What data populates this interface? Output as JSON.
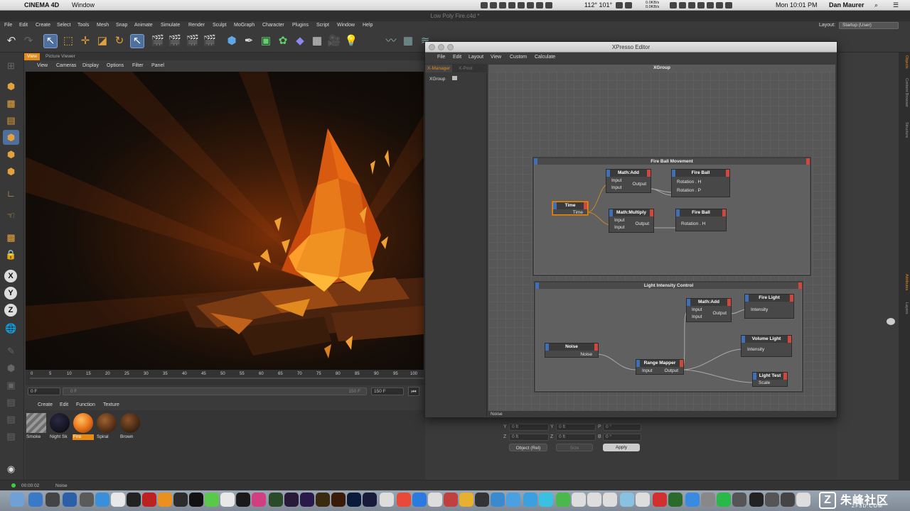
{
  "mac_menubar": {
    "app_name": "CINEMA 4D",
    "window_menu": "Window",
    "temps": "112° 101°",
    "net_up": "0.0KB/s",
    "net_down": "0.0KB/s",
    "clock": "Mon 10:01 PM",
    "user": "Dan Maurer"
  },
  "document_title": "Low Poly Fire.c4d *",
  "main_menu": [
    "File",
    "Edit",
    "Create",
    "Select",
    "Tools",
    "Mesh",
    "Snap",
    "Animate",
    "Simulate",
    "Render",
    "Sculpt",
    "MoGraph",
    "Character",
    "Plugins",
    "Script",
    "Window",
    "Help"
  ],
  "layout": {
    "label": "Layout:",
    "value": "Startup (User)"
  },
  "viewport": {
    "tabs": [
      "View",
      "Picture Viewer"
    ],
    "menu": [
      "View",
      "Cameras",
      "Display",
      "Options",
      "Filter",
      "Panel"
    ]
  },
  "timeline": {
    "ticks": [
      "0",
      "5",
      "10",
      "15",
      "20",
      "25",
      "30",
      "35",
      "40",
      "45",
      "50",
      "55",
      "60",
      "65",
      "70",
      "75",
      "80",
      "85",
      "90",
      "95",
      "100"
    ],
    "start_field": "0 F",
    "current_field": "0 F",
    "end_label": "150 F",
    "end_field": "150 F"
  },
  "materials": {
    "menu": [
      "Create",
      "Edit",
      "Function",
      "Texture"
    ],
    "items": [
      {
        "name": "Smoke",
        "color": "#8a8a8a"
      },
      {
        "name": "Night Sk",
        "color": "#1a1a2a"
      },
      {
        "name": "Fire",
        "color": "#e8741a"
      },
      {
        "name": "Spiral",
        "color": "#5a3518"
      },
      {
        "name": "Brown",
        "color": "#4a2d15"
      }
    ],
    "selected": "Fire"
  },
  "xpresso": {
    "title": "XPresso Editor",
    "menu": [
      "File",
      "Edit",
      "Layout",
      "View",
      "Custom",
      "Calculate"
    ],
    "tabs": [
      "X-Manager",
      "X-Pool"
    ],
    "tree_item": "XGroup",
    "canvas_title": "XGroup",
    "status": "Noise",
    "groups": [
      {
        "title": "Fire Ball Movement",
        "nodes": {
          "time": {
            "title": "Time",
            "ports": [
              "Time"
            ]
          },
          "math_add": {
            "title": "Math:Add",
            "inputs": [
              "Input",
              "Input"
            ],
            "output": "Output"
          },
          "math_mul": {
            "title": "Math:Multiply",
            "inputs": [
              "Input",
              "Input"
            ],
            "output": "Output"
          },
          "fireball1": {
            "title": "Fire Ball",
            "ports": [
              "Rotation . H",
              "Rotation . P"
            ]
          },
          "fireball2": {
            "title": "Fire Ball",
            "ports": [
              "Rotation . H"
            ]
          }
        }
      },
      {
        "title": "Light Intensity Control",
        "nodes": {
          "noise": {
            "title": "Noise",
            "ports": [
              "Noise"
            ]
          },
          "range_mapper": {
            "title": "Range Mapper",
            "input": "Input",
            "output": "Output"
          },
          "math_add": {
            "title": "Math:Add",
            "inputs": [
              "Input",
              "Input"
            ],
            "output": "Output"
          },
          "fire_light": {
            "title": "Fire Light",
            "ports": [
              "Intensity"
            ]
          },
          "volume_light": {
            "title": "Volume Light",
            "ports": [
              "Intensity"
            ]
          },
          "light_test": {
            "title": "Light Test",
            "ports": [
              "Scale"
            ]
          }
        }
      }
    ]
  },
  "coords": {
    "rows": [
      {
        "axis": "Y",
        "pos": "0 ft",
        "size": "0 ft",
        "rot_label": "P",
        "rot": "0 °"
      },
      {
        "axis": "Z",
        "pos": "0 ft",
        "size": "0 ft",
        "rot_label": "B",
        "rot": "0 °"
      }
    ],
    "mode": "Object (Rel)",
    "size_mode": "Size",
    "apply": "Apply"
  },
  "right_tabs": [
    "Objects",
    "Content Browser",
    "Structure"
  ],
  "right_tabs_lower": [
    "Attributes",
    "Layers"
  ],
  "status_bar": {
    "time": "00:00:02",
    "message": "Noise"
  },
  "watermark": {
    "text": "朱峰社区",
    "url": "ZF3D.COM"
  }
}
